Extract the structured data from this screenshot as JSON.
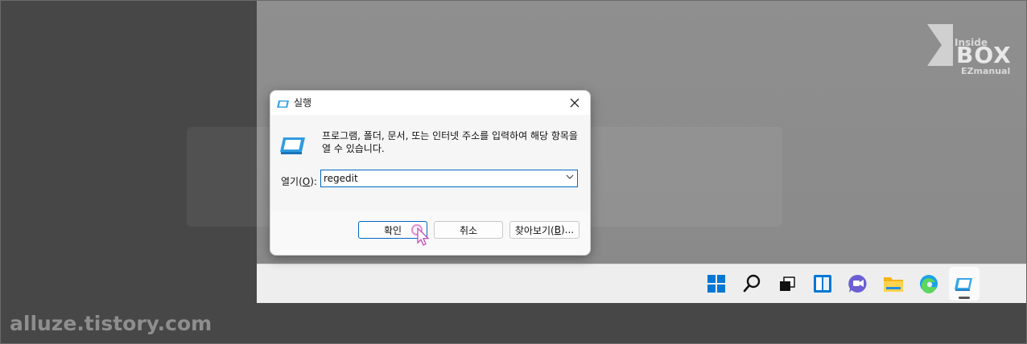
{
  "watermark": {
    "site": "alluze.tistory.com",
    "logo_top": "Inside",
    "logo_main": "BOX",
    "logo_sub": "EZmanual"
  },
  "dialog": {
    "title": "실행",
    "description": "프로그램, 폴더, 문서, 또는 인터넷 주소를 입력하여 해당 항목을 열 수 있습니다.",
    "open_label_prefix": "열기(",
    "open_label_key": "O",
    "open_label_suffix": "):",
    "input_value": "regedit",
    "ok_label": "확인",
    "cancel_label": "취소",
    "browse_label_prefix": "찾아보기(",
    "browse_label_key": "B",
    "browse_label_suffix": ")..."
  },
  "taskbar": {
    "icons": [
      "windows-start-icon",
      "search-icon",
      "task-view-icon",
      "widgets-icon",
      "teams-chat-icon",
      "file-explorer-icon",
      "edge-icon",
      "run-icon"
    ],
    "active_app": "run-icon"
  },
  "colors": {
    "accent": "#0067c0",
    "windows_blue": "#0078d4"
  }
}
